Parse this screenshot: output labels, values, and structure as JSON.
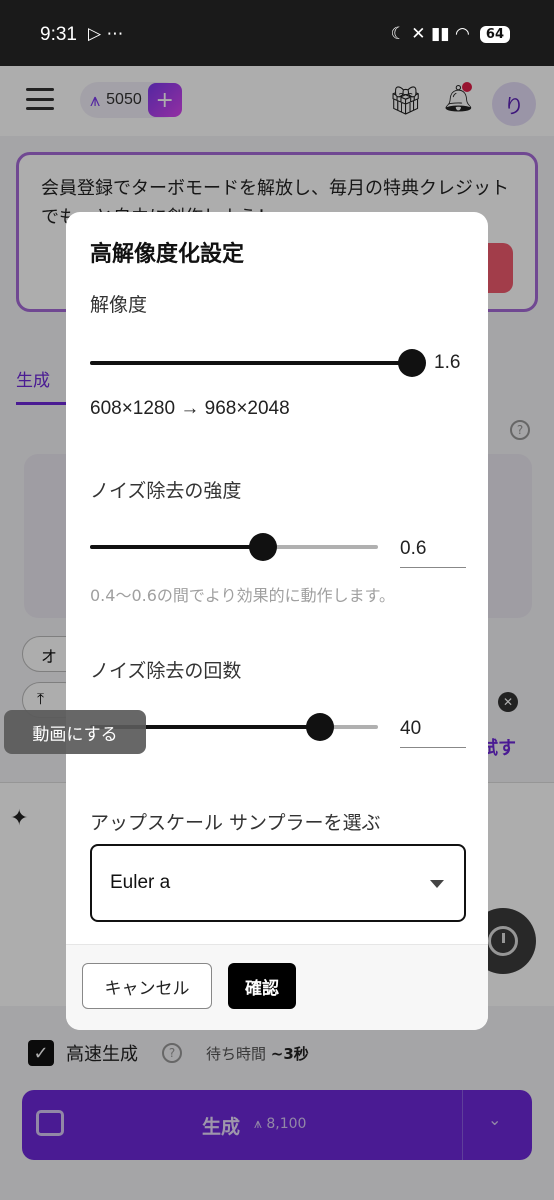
{
  "status_bar": {
    "time": "9:31",
    "left_icons": "▷ ⋯",
    "right_icons": "☾ ✕ ▮▮ ◠",
    "battery": "64"
  },
  "app": {
    "credits": "5050",
    "credit_plus": "+",
    "avatar_letter": "り",
    "promo_text": "会員登録でターボモードを解放し、毎月の特典クレジットでもっと自由に創作しよう！",
    "tab_label": "生成",
    "pill_1": "オ",
    "pill_2": "⤒",
    "try_label": "試す",
    "fast_label": "高速生成",
    "wait_label": "待ち時間",
    "wait_value": "~3秒",
    "generate_label": "生成",
    "generate_cost": "8,100",
    "video_tooltip": "動画にする"
  },
  "dialog": {
    "title": "高解像度化設定",
    "resolution_label": "解像度",
    "resolution_value": "1.6",
    "resolution_fraction": 1.0,
    "resolution_text": "608×1280 → 968×2048",
    "denoise_strength_label": "ノイズ除去の強度",
    "denoise_strength_value": "0.6",
    "denoise_strength_fraction": 0.6,
    "denoise_hint": "0.4〜0.6の間でより効果的に動作します。",
    "denoise_steps_label": "ノイズ除去の回数",
    "denoise_steps_value": "40",
    "denoise_steps_fraction": 0.8,
    "sampler_label": "アップスケール サンプラーを選ぶ",
    "sampler_value": "Euler a",
    "cancel_label": "キャンセル",
    "confirm_label": "確認"
  }
}
